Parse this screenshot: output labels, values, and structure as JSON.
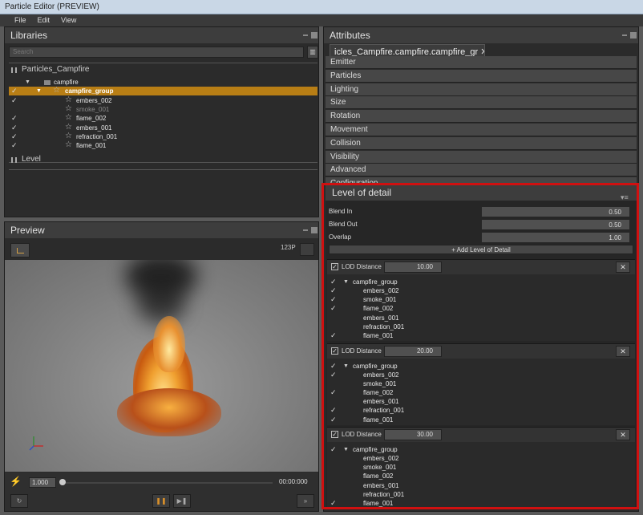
{
  "window": {
    "title": "Particle Editor (PREVIEW)"
  },
  "menu": [
    "File",
    "Edit",
    "View"
  ],
  "libraries": {
    "title": "Libraries",
    "search_placeholder": "Search",
    "library_name": "Particles_Campfire",
    "tree": [
      {
        "label": "campfire",
        "checked": false,
        "level": 0,
        "selected": false,
        "dim": false
      },
      {
        "label": "campfire_group",
        "checked": true,
        "level": 1,
        "selected": true,
        "dim": false
      },
      {
        "label": "embers_002",
        "checked": true,
        "level": 2,
        "selected": false,
        "dim": false
      },
      {
        "label": "smoke_001",
        "checked": false,
        "level": 2,
        "selected": false,
        "dim": true
      },
      {
        "label": "flame_002",
        "checked": true,
        "level": 2,
        "selected": false,
        "dim": false
      },
      {
        "label": "embers_001",
        "checked": true,
        "level": 2,
        "selected": false,
        "dim": false
      },
      {
        "label": "refraction_001",
        "checked": true,
        "level": 2,
        "selected": false,
        "dim": false
      },
      {
        "label": "flame_001",
        "checked": true,
        "level": 2,
        "selected": false,
        "dim": false
      }
    ],
    "level_label": "Level"
  },
  "preview": {
    "title": "Preview",
    "fps": "123P",
    "speed": "1.000",
    "time": "00:00:000"
  },
  "attributes": {
    "title": "Attributes",
    "tab_label": "icles_Campfire.campfire.campfire_gr",
    "categories": [
      "Emitter",
      "Particles",
      "Lighting",
      "Size",
      "Rotation",
      "Movement",
      "Collision",
      "Visibility",
      "Advanced",
      "Configuration"
    ]
  },
  "lod": {
    "title": "Level of detail",
    "blend_in_label": "Blend In",
    "blend_in": "0.50",
    "blend_out_label": "Blend Out",
    "blend_out": "0.50",
    "overlap_label": "Overlap",
    "overlap": "1.00",
    "add_label": "+ Add Level of Detail",
    "distance_label": "LOD Distance",
    "levels": [
      {
        "distance": "10.00",
        "group": "campfire_group",
        "items": [
          {
            "label": "embers_002",
            "checked": true
          },
          {
            "label": "smoke_001",
            "checked": true
          },
          {
            "label": "flame_002",
            "checked": true
          },
          {
            "label": "embers_001",
            "checked": false
          },
          {
            "label": "refraction_001",
            "checked": false
          },
          {
            "label": "flame_001",
            "checked": true
          }
        ]
      },
      {
        "distance": "20.00",
        "group": "campfire_group",
        "items": [
          {
            "label": "embers_002",
            "checked": true
          },
          {
            "label": "smoke_001",
            "checked": false
          },
          {
            "label": "flame_002",
            "checked": true
          },
          {
            "label": "embers_001",
            "checked": false
          },
          {
            "label": "refraction_001",
            "checked": true
          },
          {
            "label": "flame_001",
            "checked": true
          }
        ]
      },
      {
        "distance": "30.00",
        "group": "campfire_group",
        "items": [
          {
            "label": "embers_002",
            "checked": false
          },
          {
            "label": "smoke_001",
            "checked": false
          },
          {
            "label": "flame_002",
            "checked": false
          },
          {
            "label": "embers_001",
            "checked": false
          },
          {
            "label": "refraction_001",
            "checked": false
          },
          {
            "label": "flame_001",
            "checked": true
          }
        ]
      }
    ]
  },
  "colors": {
    "accent": "#b87e15",
    "highlight": "#d01010"
  },
  "icons": [
    "library-icon",
    "star-icon",
    "check-icon",
    "close-icon",
    "bolt-icon",
    "pause-icon",
    "step-icon",
    "axes-icon"
  ]
}
